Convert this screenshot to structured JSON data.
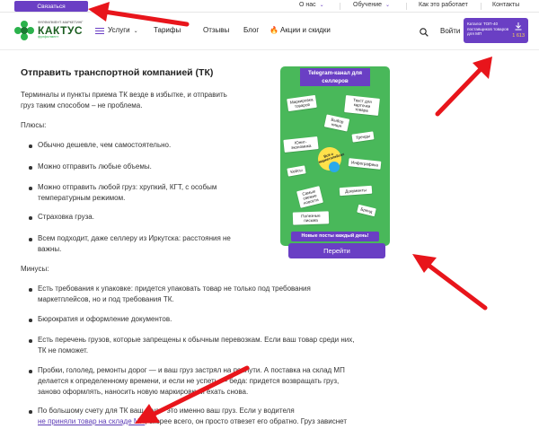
{
  "topbar": {
    "contact": "Связаться",
    "about": "О нас",
    "learning": "Обучение",
    "how_works": "Как это работает",
    "contacts": "Контакты"
  },
  "logo": {
    "small": "ФУЛФИЛМЕНТ-МАРКЕТИНГ",
    "name": "КАКТУС",
    "sub": "фулфилмент"
  },
  "nav": {
    "services": "Услуги",
    "tariffs": "Тарифы",
    "reviews": "Отзывы",
    "blog": "Блог",
    "promos": "Акции и скидки",
    "login": "Войти"
  },
  "catalog": {
    "text": "Каталог ТОП-40 поставщиков товаров для МП",
    "size": "1 613"
  },
  "article": {
    "heading": "Отправить транспортной компанией (ТК)",
    "intro_line1": "Терминалы и пункты приема ТК везде в избытке, и отправить",
    "intro_line2": "груз таким способом – не проблема.",
    "pros_title": "Плюсы:",
    "pros": [
      "Обычно дешевле, чем самостоятельно.",
      "Можно отправить любые объемы.",
      "Можно отправить любой груз: хрупкий, КГТ, с особым",
      "температурным режимом.",
      "Страховка груза.",
      "Всем подходит, даже селлеру из Иркутска: расстояния не",
      "важны."
    ],
    "cons_title": "Минусы:",
    "cons": [
      "Есть требования к упаковке: придется упаковать товар не только под требования",
      "маркетплейсов, но и под требования ТК.",
      "Бюрократия и оформление документов.",
      "Есть перечень грузов, которые запрещены к обычным перевозкам. Если ваш товар среди них,",
      "ТК не поможет.",
      "Пробки, гололед, ремонты дорог — и ваш груз застрял на полпути. А поставка на склад МП",
      "делается к определенному времени, и если не успеть — беда: придется возвращать груз,",
      "заново оформлять, наносить новую маркировку и ехать снова.",
      "По большому счету для ТК ваш груз – это именно ваш груз. Если у водителя",
      "не приняли товар на складе МП",
      ", скорее всего, он просто отвезет его обратно. Груз зависнет"
    ]
  },
  "banner": {
    "title": "Telegram-канал для селлеров",
    "notes": [
      "Маркировка товаров",
      "Текст для карточки товара",
      "Выбор ниши",
      "Юнит-экономика",
      "Тренды",
      "Всё о маркетплейсах",
      "Кейсы",
      "Инфографика",
      "Самые свежие новости",
      "Документы",
      "Бренд",
      "Полезные письма"
    ],
    "bottom": "Новые посты каждый день!",
    "button": "Перейти"
  },
  "colors": {
    "accent": "#6a3fc4",
    "green": "#49b85a",
    "arrow": "#e8151b"
  }
}
